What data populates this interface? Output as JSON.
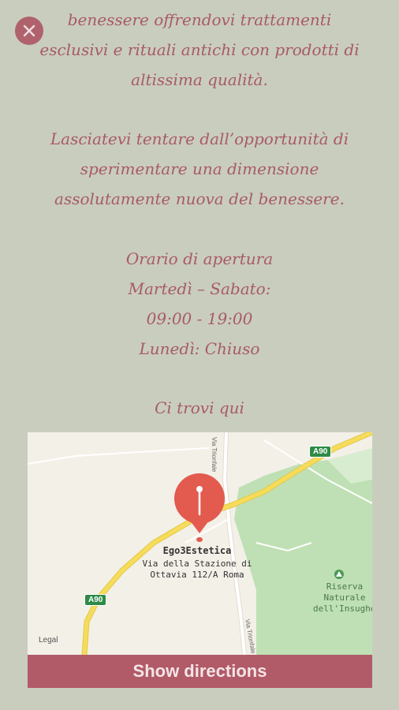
{
  "text": {
    "intro_lines": [
      "benessere offrendovi trattamenti",
      "esclusivi e rituali antichi con prodotti di",
      "altissima qualità."
    ],
    "tempt_lines": [
      "Lasciatevi tentare dall’opportunità di",
      "sperimentare una dimensione",
      "assolutamente nuova del benessere."
    ],
    "hours_lines": [
      "Orario di apertura",
      "Martedì – Sabato:",
      "09:00 - 19:00",
      "Lunedì: Chiuso"
    ],
    "find_us": "Ci trovi qui"
  },
  "map": {
    "place_name": "Ego3Estetica",
    "address_line1": "Via della Stazione di",
    "address_line2": "Ottavia 112/A Roma",
    "highway_badge": "A90",
    "park_lines": [
      "Riserva",
      "Naturale",
      "dell'Insughera"
    ],
    "road_label_top": "Via Trionfale",
    "road_label_bottom": "Via Trionfale",
    "legal": "Legal"
  },
  "buttons": {
    "show_directions": "Show directions"
  },
  "colors": {
    "background": "#c9cdbd",
    "text": "#a85a6a",
    "accent": "#b15a68",
    "pin": "#e35a4f"
  }
}
